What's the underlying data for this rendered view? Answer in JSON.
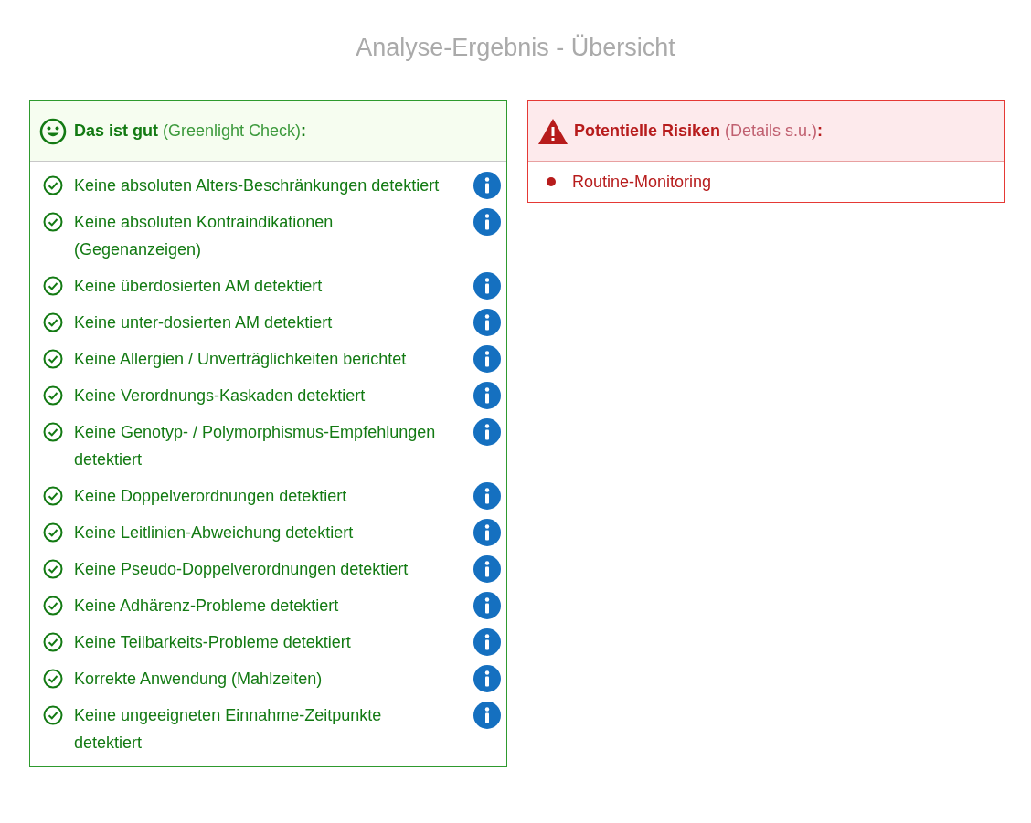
{
  "title": "Analyse-Ergebnis - Übersicht",
  "good": {
    "heading": "**Das ist gut** (Greenlight Check)**:**",
    "items": [
      {
        "text": "Keine absoluten Alters-Beschränkungen detektiert"
      },
      {
        "text": "Keine absoluten Kontraindikationen (Gegenanzeigen)"
      },
      {
        "text": "Keine überdosierten AM detektiert"
      },
      {
        "text": "Keine unter-dosierten AM detektiert"
      },
      {
        "text": "Keine Allergien / Unverträglichkeiten berichtet"
      },
      {
        "text": "Keine Verordnungs-Kaskaden detektiert"
      },
      {
        "text": "Keine Genotyp- / Polymorphismus-Empfehlungen detektiert"
      },
      {
        "text": "Keine Doppelverordnungen detektiert"
      },
      {
        "text": "Keine Leitlinien-Abweichung detektiert"
      },
      {
        "text": "Keine Pseudo-Doppelverordnungen detektiert"
      },
      {
        "text": "Keine Adhärenz-Probleme detektiert"
      },
      {
        "text": "Keine Teilbarkeits-Probleme detektiert"
      },
      {
        "text": "Korrekte Anwendung (Mahlzeiten)"
      },
      {
        "text": "Keine ungeeigneten Einnahme-Zeitpunkte detektiert"
      }
    ]
  },
  "risks": {
    "heading": "**Potentielle Risiken** (Details s.u.)**:**",
    "items": [
      {
        "text": "Routine-Monitoring"
      }
    ]
  }
}
